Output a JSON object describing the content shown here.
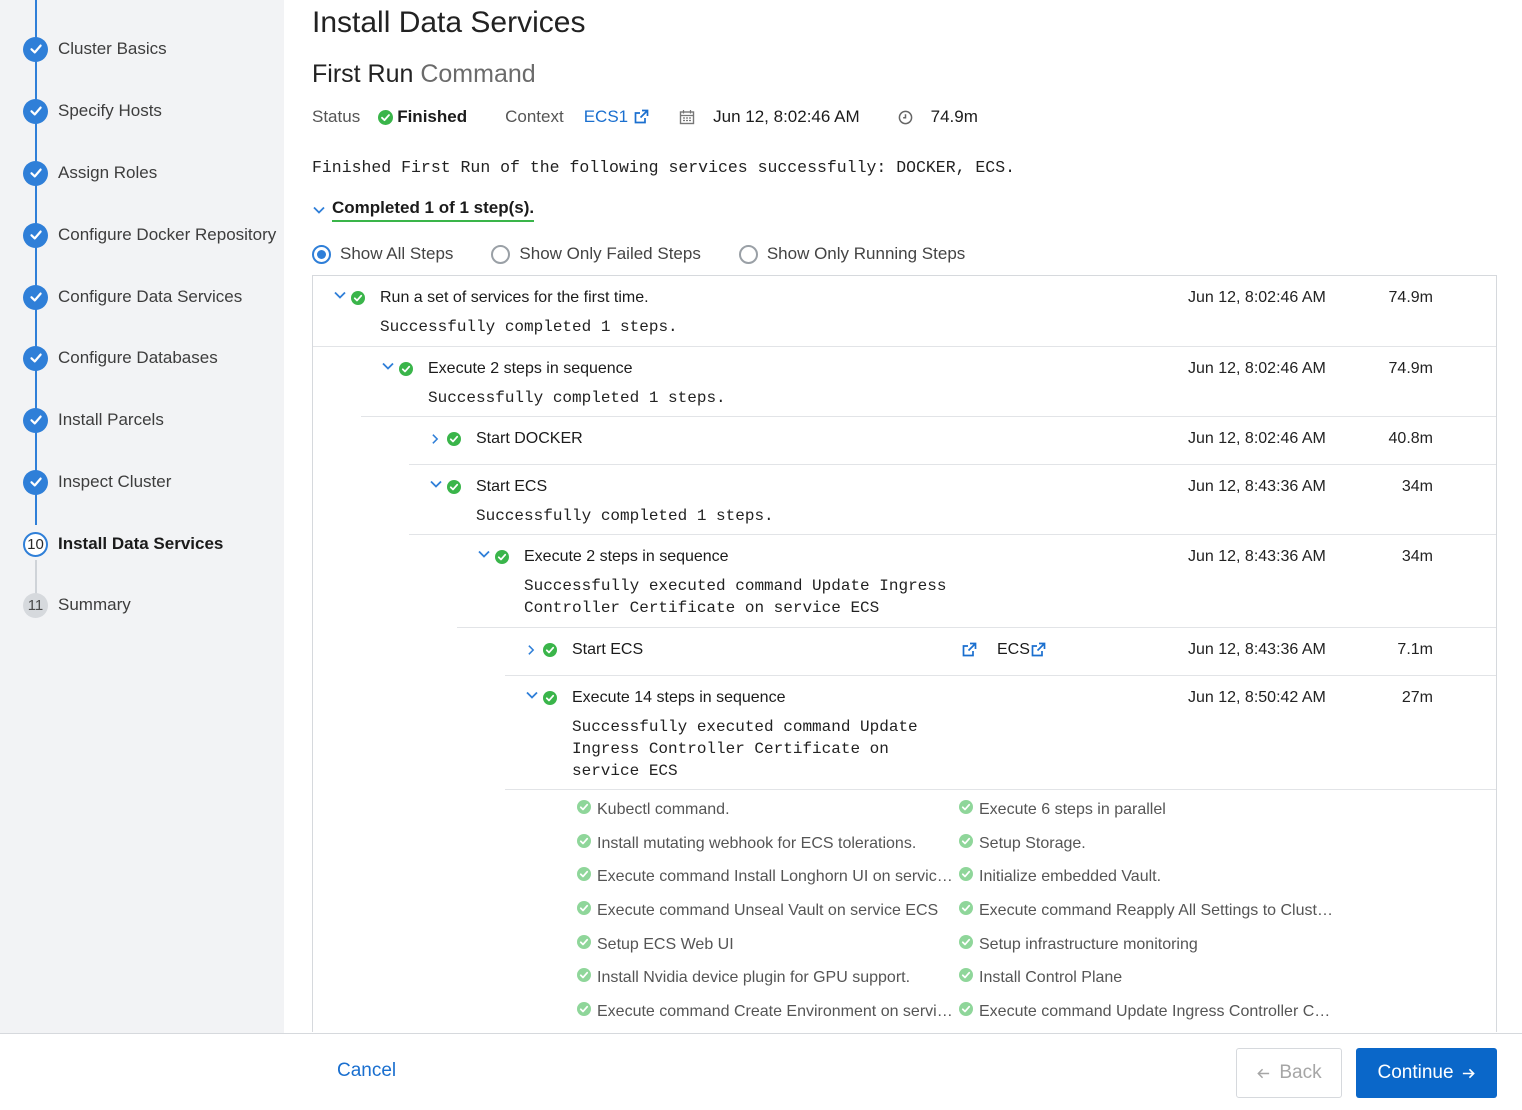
{
  "sidebar": {
    "steps": [
      {
        "label": "Cluster Basics",
        "state": "done"
      },
      {
        "label": "Specify Hosts",
        "state": "done"
      },
      {
        "label": "Assign Roles",
        "state": "done"
      },
      {
        "label": "Configure Docker Repository",
        "state": "done"
      },
      {
        "label": "Configure Data Services",
        "state": "done"
      },
      {
        "label": "Configure Databases",
        "state": "done"
      },
      {
        "label": "Install Parcels",
        "state": "done"
      },
      {
        "label": "Inspect Cluster",
        "state": "done"
      },
      {
        "label": "Install Data Services",
        "state": "current",
        "number": "10"
      },
      {
        "label": "Summary",
        "state": "pending",
        "number": "11"
      }
    ]
  },
  "header": {
    "page_title": "Install Data Services",
    "command_title_main": "First Run",
    "command_title_soft": " Command"
  },
  "status": {
    "status_key": "Status",
    "status_value": "Finished",
    "context_key": "Context",
    "context_value": "ECS1",
    "started": "Jun 12, 8:02:46 AM",
    "duration": "74.9m"
  },
  "summary_text": "Finished First Run of the following services successfully: DOCKER, ECS.",
  "completed_text": "Completed 1 of 1 step(s).",
  "filters": {
    "all": "Show All Steps",
    "failed": "Show Only Failed Steps",
    "running": "Show Only Running Steps",
    "selected": "all"
  },
  "steps": {
    "r1": {
      "title": "Run a set of services for the first time.",
      "sub": "Successfully completed 1 steps.",
      "date": "Jun 12, 8:02:46 AM",
      "dur": "74.9m"
    },
    "r2": {
      "title": "Execute 2 steps in sequence",
      "sub": "Successfully completed 1 steps.",
      "date": "Jun 12, 8:02:46 AM",
      "dur": "74.9m"
    },
    "r3": {
      "title": "Start DOCKER",
      "date": "Jun 12, 8:02:46 AM",
      "dur": "40.8m"
    },
    "r4": {
      "title": "Start ECS",
      "sub": "Successfully completed 1 steps.",
      "date": "Jun 12, 8:43:36 AM",
      "dur": "34m"
    },
    "r5": {
      "title": "Execute 2 steps in sequence",
      "sub1": "Successfully executed command Update Ingress",
      "sub2": "Controller Certificate on service ECS",
      "date": "Jun 12, 8:43:36 AM",
      "dur": "34m"
    },
    "r6": {
      "title": "Start ECS",
      "link": "ECS",
      "date": "Jun 12, 8:43:36 AM",
      "dur": "7.1m"
    },
    "r7": {
      "title": "Execute 14 steps in sequence",
      "sub1": "Successfully executed command Update",
      "sub2": "Ingress Controller Certificate on",
      "sub3": "service ECS",
      "date": "Jun 12, 8:50:42 AM",
      "dur": "27m"
    }
  },
  "substeps": {
    "left": [
      "Kubectl command.",
      "Install mutating webhook for ECS tolerations.",
      "Execute command Install Longhorn UI on servic…",
      "Execute command Unseal Vault on service ECS",
      "Setup ECS Web UI",
      "Install Nvidia device plugin for GPU support.",
      "Execute command Create Environment on servi…"
    ],
    "right": [
      "Execute 6 steps in parallel",
      "Setup Storage.",
      "Initialize embedded Vault.",
      "Execute command Reapply All Settings to Clust…",
      "Setup infrastructure monitoring",
      "Install Control Plane",
      "Execute command Update Ingress Controller C…"
    ]
  },
  "footer": {
    "cancel": "Cancel",
    "back": "Back",
    "continue": "Continue"
  },
  "colors": {
    "accent": "#2f7fd8",
    "success": "#3ab54a",
    "primary_button": "#0a67c9"
  }
}
